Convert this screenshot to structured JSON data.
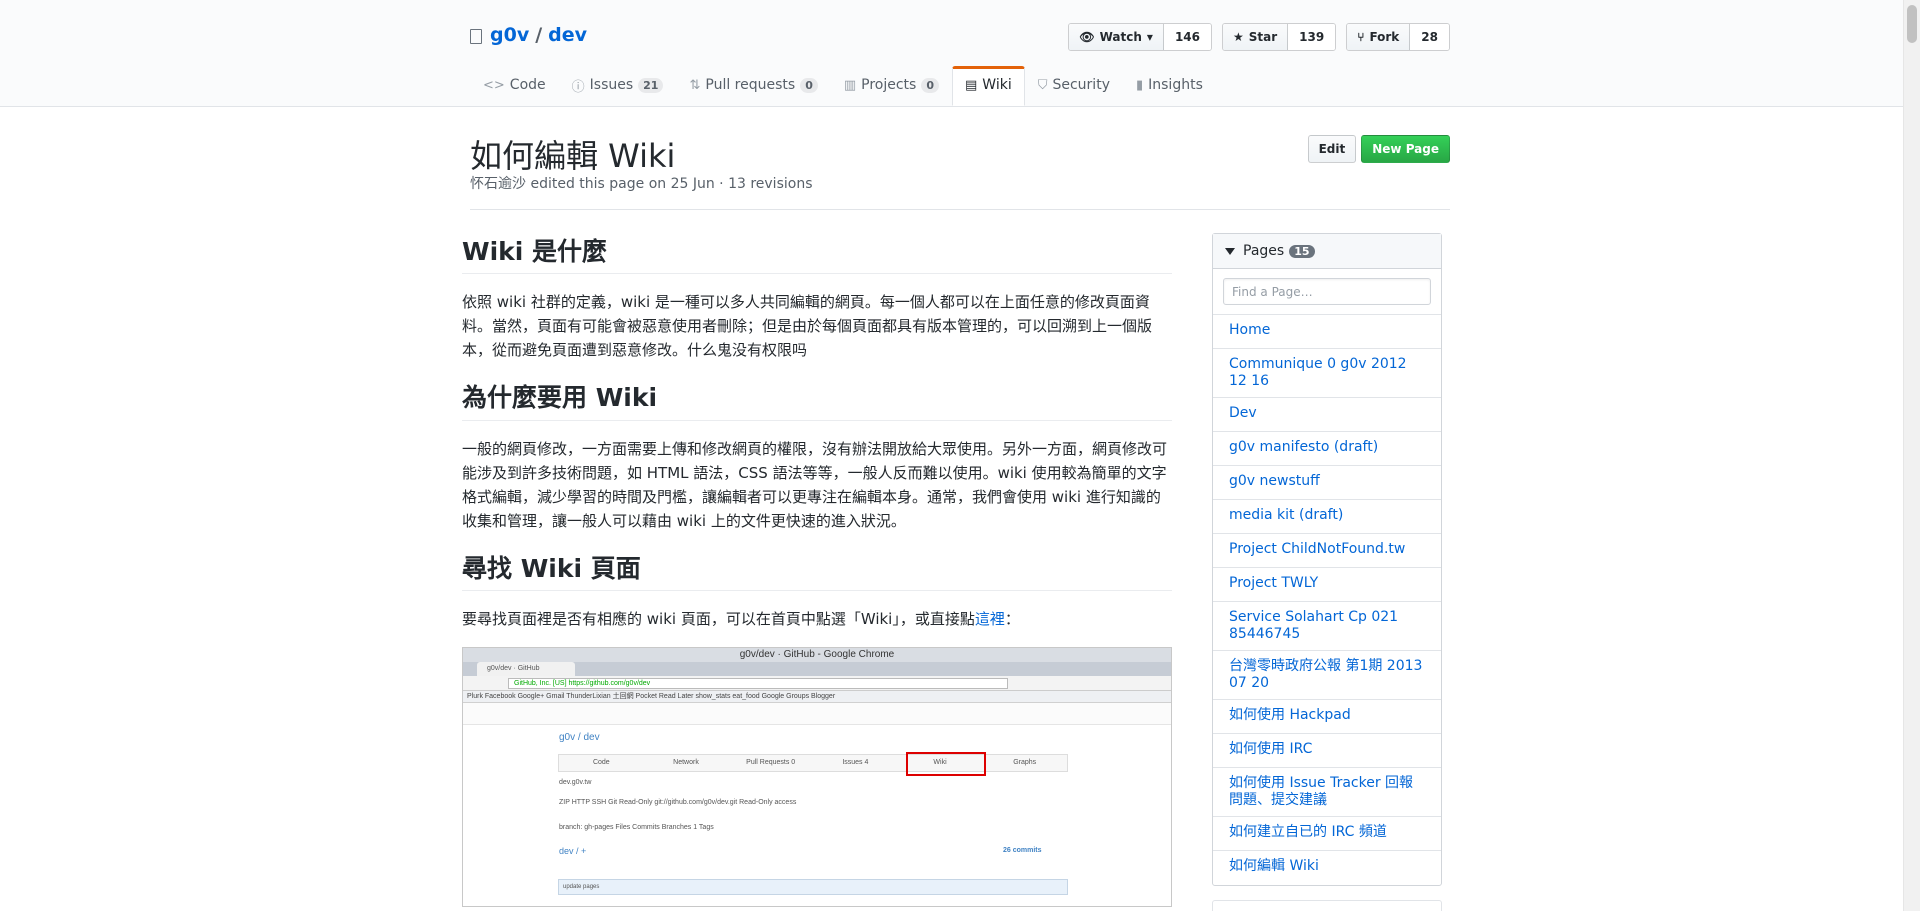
{
  "repo": {
    "owner": "g0v",
    "separator": "/",
    "name": "dev"
  },
  "actions": {
    "watch_label": "Watch",
    "watch_count": "146",
    "star_label": "Star",
    "star_count": "139",
    "fork_label": "Fork",
    "fork_count": "28"
  },
  "nav": {
    "code": "Code",
    "issues": "Issues",
    "issues_count": "21",
    "pulls": "Pull requests",
    "pulls_count": "0",
    "projects": "Projects",
    "projects_count": "0",
    "wiki": "Wiki",
    "security": "Security",
    "insights": "Insights"
  },
  "header": {
    "title": "如何編輯 Wiki",
    "author": "怀石逾沙",
    "meta": " edited this page on 25 Jun · 13 revisions",
    "edit_label": "Edit",
    "new_page_label": "New Page"
  },
  "content": {
    "h1": "Wiki 是什麼",
    "p1": "依照 wiki 社群的定義，wiki 是一種可以多人共同編輯的網頁。每一個人都可以在上面任意的修改頁面資料。當然，頁面有可能會被惡意使用者刪除；但是由於每個頁面都具有版本管理的，可以回溯到上一個版本，從而避免頁面遭到惡意修改。什么鬼没有权限吗",
    "h2": "為什麼要用 Wiki",
    "p2": "一般的網頁修改，一方面需要上傳和修改網頁的權限，沒有辦法開放給大眾使用。另外一方面，網頁修改可能涉及到許多技術問題，如 HTML 語法，CSS 語法等等，一般人反而難以使用。wiki 使用較為簡單的文字格式編輯，減少學習的時間及門檻，讓編輯者可以更專注在編輯本身。通常，我們會使用 wiki 進行知識的收集和管理，讓一般人可以藉由 wiki 上的文件更快速的進入狀況。",
    "h3": "尋找 Wiki 頁面",
    "p3_text": "要尋找頁面裡是否有相應的 wiki 頁面，可以在首頁中點選「Wiki」，或直接點",
    "p3_link": "這裡",
    "p3_end": "："
  },
  "screenshot": {
    "window_title": "g0v/dev · GitHub - Google Chrome",
    "tab_title": "g0v/dev · GitHub",
    "url": "GitHub, Inc. [US] https://github.com/g0v/dev",
    "bookmarks": "Plurk  Facebook  Google+  Gmail  ThunderLixian  土回網  Pocket  Read Later  show_stats  eat_food  Google Groups  Blogger",
    "repo_path": "g0v / dev",
    "tabs": [
      "Code",
      "Network",
      "Pull Requests 0",
      "Issues 4",
      "Wiki",
      "Graphs"
    ],
    "desc": "dev.g0v.tw",
    "clone_row": "ZIP   HTTP   SSH   Git Read-Only   git://github.com/g0v/dev.git   Read-Only access",
    "branch_row": "branch: gh-pages   Files   Commits   Branches 1                                   Tags",
    "dir_row": "dev / +",
    "commits": "26 commits",
    "update": "update pages"
  },
  "sidebar": {
    "title": "Pages",
    "count": "15",
    "filter_placeholder": "Find a Page…",
    "pages": [
      "Home",
      "Communique 0 g0v 2012 12 16",
      "Dev",
      "g0v manifesto (draft)",
      "g0v newstuff",
      "media kit (draft)",
      "Project ChildNotFound.tw",
      "Project TWLY",
      "Service Solahart Cp 021 85446745",
      "台灣零時政府公報 第1期 2013 07 20",
      "如何使用 Hackpad",
      "如何使用 IRC",
      "如何使用 Issue Tracker 回報問題、提交建議",
      "如何建立自已的 IRC 頻道",
      "如何編輯 Wiki"
    ]
  }
}
